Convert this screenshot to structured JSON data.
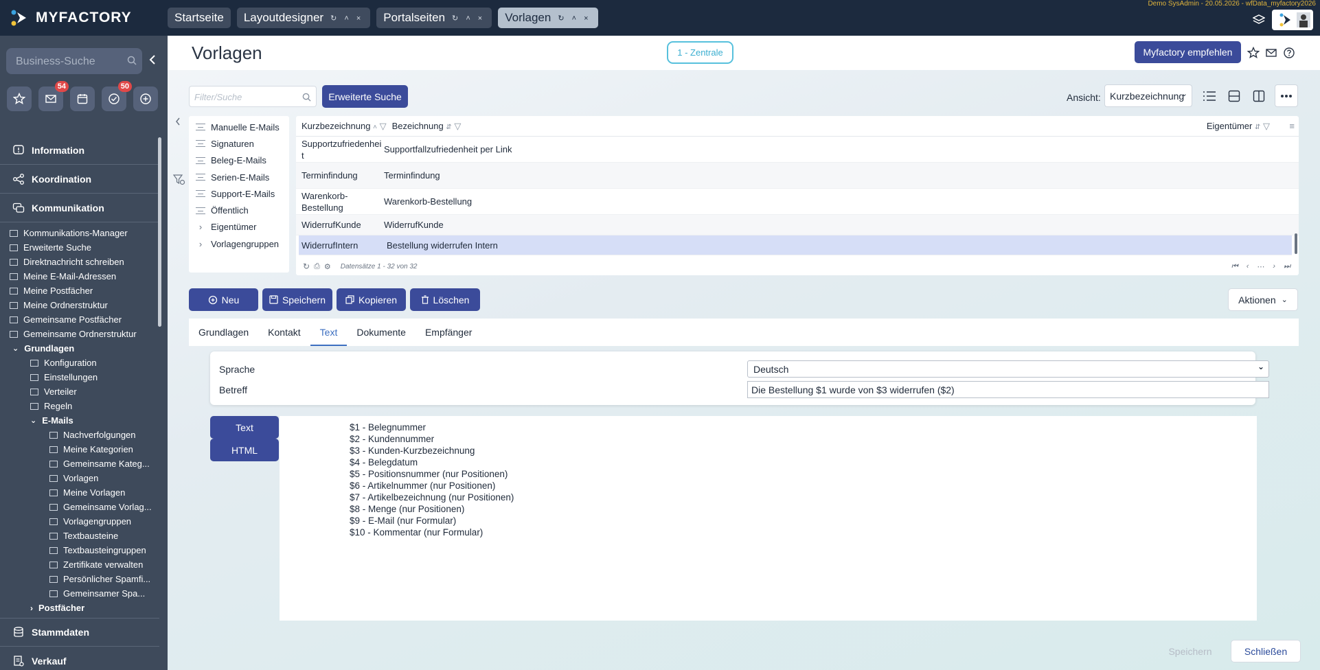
{
  "topbar": {
    "logo": "MYFACTORY",
    "tabs": [
      {
        "label": "Startseite",
        "controls": ""
      },
      {
        "label": "Layoutdesigner",
        "controls": "↻ ˄ ×"
      },
      {
        "label": "Portalseiten",
        "controls": "↻ ˄ ×"
      },
      {
        "label": "Vorlagen",
        "controls": "↻ ˄ ×"
      }
    ],
    "sysinfo": "Demo SysAdmin - 20.05.2026 - wfData_myfactory2026",
    "icons": [
      "layers-icon",
      "user-avatar"
    ]
  },
  "sidebar": {
    "search_placeholder": "Business-Suche",
    "quick_buttons": [
      {
        "icon": "star-icon",
        "badge": ""
      },
      {
        "icon": "mail-icon",
        "badge": "54"
      },
      {
        "icon": "calendar-icon",
        "badge": ""
      },
      {
        "icon": "check-icon",
        "badge": "50"
      },
      {
        "icon": "plus-icon",
        "badge": ""
      }
    ],
    "sections": {
      "information": "Information",
      "koordination": "Koordination",
      "kommunikation": "Kommunikation",
      "stammdaten": "Stammdaten",
      "verkauf": "Verkauf"
    },
    "komm_items": [
      "Kommunikations-Manager",
      "Erweiterte Suche",
      "Direktnachricht schreiben",
      "Meine E-Mail-Adressen",
      "Meine Postfächer",
      "Meine Ordnerstruktur",
      "Gemeinsame Postfächer",
      "Gemeinsame Ordnerstruktur"
    ],
    "grundlagen": "Grundlagen",
    "grundlagen_items": [
      "Konfiguration",
      "Einstellungen",
      "Verteiler",
      "Regeln"
    ],
    "emails": "E-Mails",
    "email_items": [
      "Nachverfolgungen",
      "Meine Kategorien",
      "Gemeinsame Kateg...",
      "Vorlagen",
      "Meine Vorlagen",
      "Gemeinsame Vorlag...",
      "Vorlagengruppen",
      "Textbausteine",
      "Textbausteingruppen",
      "Zertifikate verwalten",
      "Persönlicher Spamfi...",
      "Gemeinsamer Spa..."
    ],
    "postfaecher": "Postfächer"
  },
  "header": {
    "title": "Vorlagen",
    "zentrale": "1 - Zentrale",
    "empfehlen": "Myfactory empfehlen"
  },
  "toolbar": {
    "filter_placeholder": "Filter/Suche",
    "erweiterte_suche": "Erweiterte Suche",
    "ansicht_label": "Ansicht:",
    "ansicht_value": "Kurzbezeichnung"
  },
  "tree": [
    "Manuelle E-Mails",
    "Signaturen",
    "Beleg-E-Mails",
    "Serien-E-Mails",
    "Support-E-Mails",
    "Öffentlich",
    "Eigentümer",
    "Vorlagengruppen"
  ],
  "grid": {
    "columns": [
      "Kurzbezeichnung",
      "Bezeichnung",
      "Eigentümer"
    ],
    "rows": [
      {
        "kurz": "Supportzufriedenheit",
        "bez": "Supportfallzufriedenheit per Link"
      },
      {
        "kurz": "Terminfindung",
        "bez": "Terminfindung"
      },
      {
        "kurz": "Warenkorb-Bestellung",
        "bez": "Warenkorb-Bestellung"
      },
      {
        "kurz": "WiderrufKunde",
        "bez": "WiderrufKunde"
      },
      {
        "kurz": "WiderrufIntern",
        "bez": "Bestellung widerrufen Intern"
      }
    ],
    "footer": "Datensätze 1 - 32 von 32"
  },
  "actions": {
    "neu": "Neu",
    "speichern": "Speichern",
    "kopieren": "Kopieren",
    "loeschen": "Löschen",
    "aktionen": "Aktionen"
  },
  "detail_tabs": [
    "Grundlagen",
    "Kontakt",
    "Text",
    "Dokumente",
    "Empfänger"
  ],
  "form": {
    "sprache_label": "Sprache",
    "sprache_value": "Deutsch",
    "betreff_label": "Betreff",
    "betreff_value": "Die Bestellung $1 wurde von $3 widerrufen ($2)"
  },
  "editor": {
    "tab_text": "Text",
    "tab_html": "HTML",
    "lines": [
      "$1 - Belegnummer",
      "$2 - Kundennummer",
      "$3 - Kunden-Kurzbezeichnung",
      "$4 - Belegdatum",
      "$5 - Positionsnummer (nur Positionen)",
      "$6 - Artikelnummer (nur Positionen)",
      "$7 - Artikelbezeichnung (nur Positionen)",
      "$8 - Menge (nur Positionen)",
      "$9 - E-Mail (nur Formular)",
      "$10 - Kommentar (nur Formular)"
    ]
  },
  "bottom": {
    "speichern": "Speichern",
    "schliessen": "Schließen"
  },
  "colors": {
    "topbar": "#1c2a3e",
    "sidebar": "#3e4a5b",
    "primary": "#3b4b9a",
    "badge": "#e04848",
    "selection": "#d6def7"
  }
}
